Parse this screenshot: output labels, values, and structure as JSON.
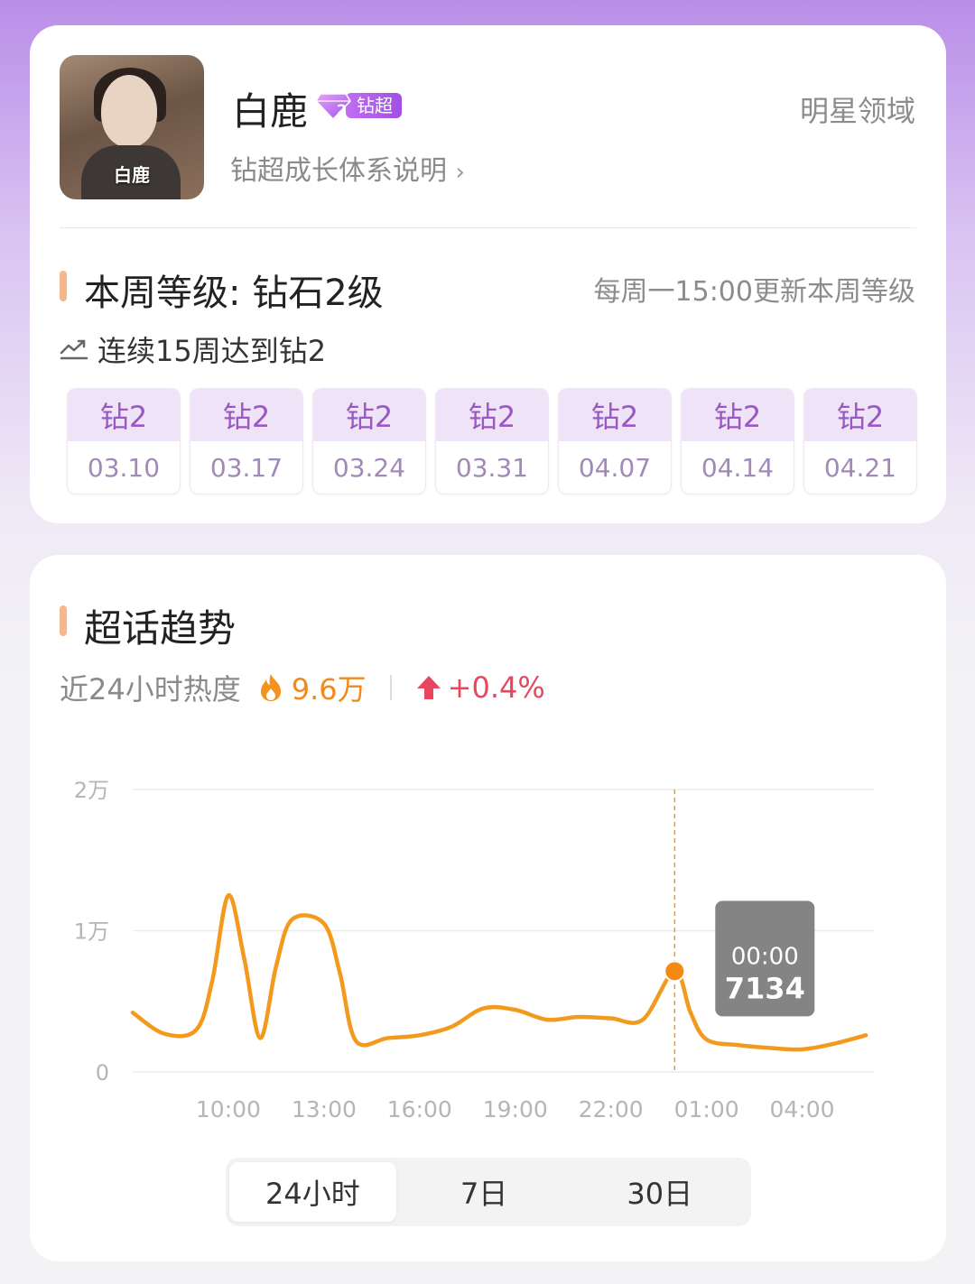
{
  "profile": {
    "name": "白鹿",
    "avatar_caption": "白鹿",
    "badge_label": "钻超",
    "badge_level": "2",
    "growth_link": "钻超成长体系说明",
    "domain_link": "明星领域"
  },
  "level": {
    "title": "本周等级: 钻石2级",
    "update_note": "每周一15:00更新本周等级",
    "streak": "连续15周达到钻2",
    "weeks": [
      {
        "level": "钻2",
        "date": "03.10"
      },
      {
        "level": "钻2",
        "date": "03.17"
      },
      {
        "level": "钻2",
        "date": "03.24"
      },
      {
        "level": "钻2",
        "date": "03.31"
      },
      {
        "level": "钻2",
        "date": "04.07"
      },
      {
        "level": "钻2",
        "date": "04.14"
      },
      {
        "level": "钻2",
        "date": "04.21"
      }
    ]
  },
  "trend": {
    "title": "超话趋势",
    "heat_label": "近24小时热度",
    "heat_value": "9.6万",
    "change": "+0.4%"
  },
  "chart_data": {
    "type": "line",
    "x_ticks": [
      "10:00",
      "13:00",
      "16:00",
      "19:00",
      "22:00",
      "01:00",
      "04:00"
    ],
    "y_ticks": [
      "0",
      "1万",
      "2万"
    ],
    "ylim": [
      0,
      20000
    ],
    "series": [
      {
        "points": [
          [
            "07:00",
            4200
          ],
          [
            "08:00",
            2700
          ],
          [
            "09:00",
            3000
          ],
          [
            "09:30",
            6500
          ],
          [
            "10:00",
            12500
          ],
          [
            "10:30",
            8000
          ],
          [
            "11:00",
            2400
          ],
          [
            "11:30",
            7500
          ],
          [
            "12:00",
            10800
          ],
          [
            "13:00",
            10500
          ],
          [
            "13:30",
            7000
          ],
          [
            "14:00",
            2200
          ],
          [
            "15:00",
            2400
          ],
          [
            "16:00",
            2600
          ],
          [
            "17:00",
            3200
          ],
          [
            "18:00",
            4500
          ],
          [
            "19:00",
            4400
          ],
          [
            "20:00",
            3700
          ],
          [
            "21:00",
            3900
          ],
          [
            "22:00",
            3800
          ],
          [
            "23:00",
            3700
          ],
          [
            "00:00",
            7134
          ],
          [
            "00:30",
            4200
          ],
          [
            "01:00",
            2300
          ],
          [
            "02:00",
            1900
          ],
          [
            "03:00",
            1700
          ],
          [
            "04:00",
            1600
          ],
          [
            "05:00",
            2000
          ],
          [
            "06:00",
            2600
          ]
        ],
        "color": "#f39a1e"
      }
    ],
    "tooltip": {
      "time": "00:00",
      "value": "7134"
    },
    "grid": true
  },
  "range_tabs": [
    {
      "label": "24小时",
      "active": true
    },
    {
      "label": "7日",
      "active": false
    },
    {
      "label": "30日",
      "active": false
    }
  ],
  "colors": {
    "accent": "#f6b78d",
    "line": "#f39a1e",
    "heat": "#f08a1c",
    "up": "#e8465e",
    "badge": "#b05ef0"
  }
}
